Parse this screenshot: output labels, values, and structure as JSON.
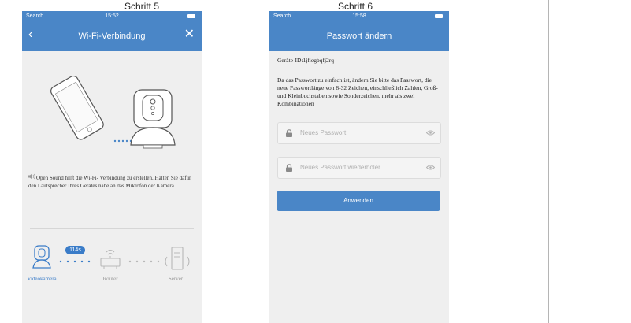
{
  "steps": [
    "Schritt 5",
    "Schritt 6"
  ],
  "phone1": {
    "status": {
      "carrier": "Search",
      "time": "15:52"
    },
    "nav": {
      "title": "Wi-Fi-Verbindung",
      "back_glyph": "‹",
      "close_glyph": "✕"
    },
    "instruction": "Open Sound hilft die Wi-Fi- Verbindung zu erstellen. Halten Sie dafür den Lautsprecher Ihres Gerätes nahe an das Mikrofon der Kamera.",
    "timer": "114s",
    "progress_labels": [
      "Videokamera",
      "Router",
      "Server"
    ],
    "icons": [
      "phone-icon",
      "camera-icon",
      "speaker-icon",
      "router-icon",
      "server-icon"
    ],
    "colors": {
      "accent": "#4a86c7",
      "active": "#3a7cc8",
      "inactive": "#b8b8b8"
    }
  },
  "phone2": {
    "status": {
      "carrier": "Search",
      "time": "15:58"
    },
    "nav": {
      "title": "Passwort ändern"
    },
    "device_id": "Geräte-ID:1jfiegbqfj2rq",
    "description": "Da das Passwort zu einfach ist, ändern Sie bitte das Passwort, die neue Passwortlänge von 8-32 Zeichen, einschließlich Zahlen, Groß- und Kleinbuchstaben sowie Sonderzeichen, mehr als zwei Kombinationen",
    "fields": [
      {
        "placeholder": "Neues Passwort",
        "value": ""
      },
      {
        "placeholder": "Neues Passwort wiederholer",
        "value": ""
      }
    ],
    "apply_label": "Anwenden"
  }
}
